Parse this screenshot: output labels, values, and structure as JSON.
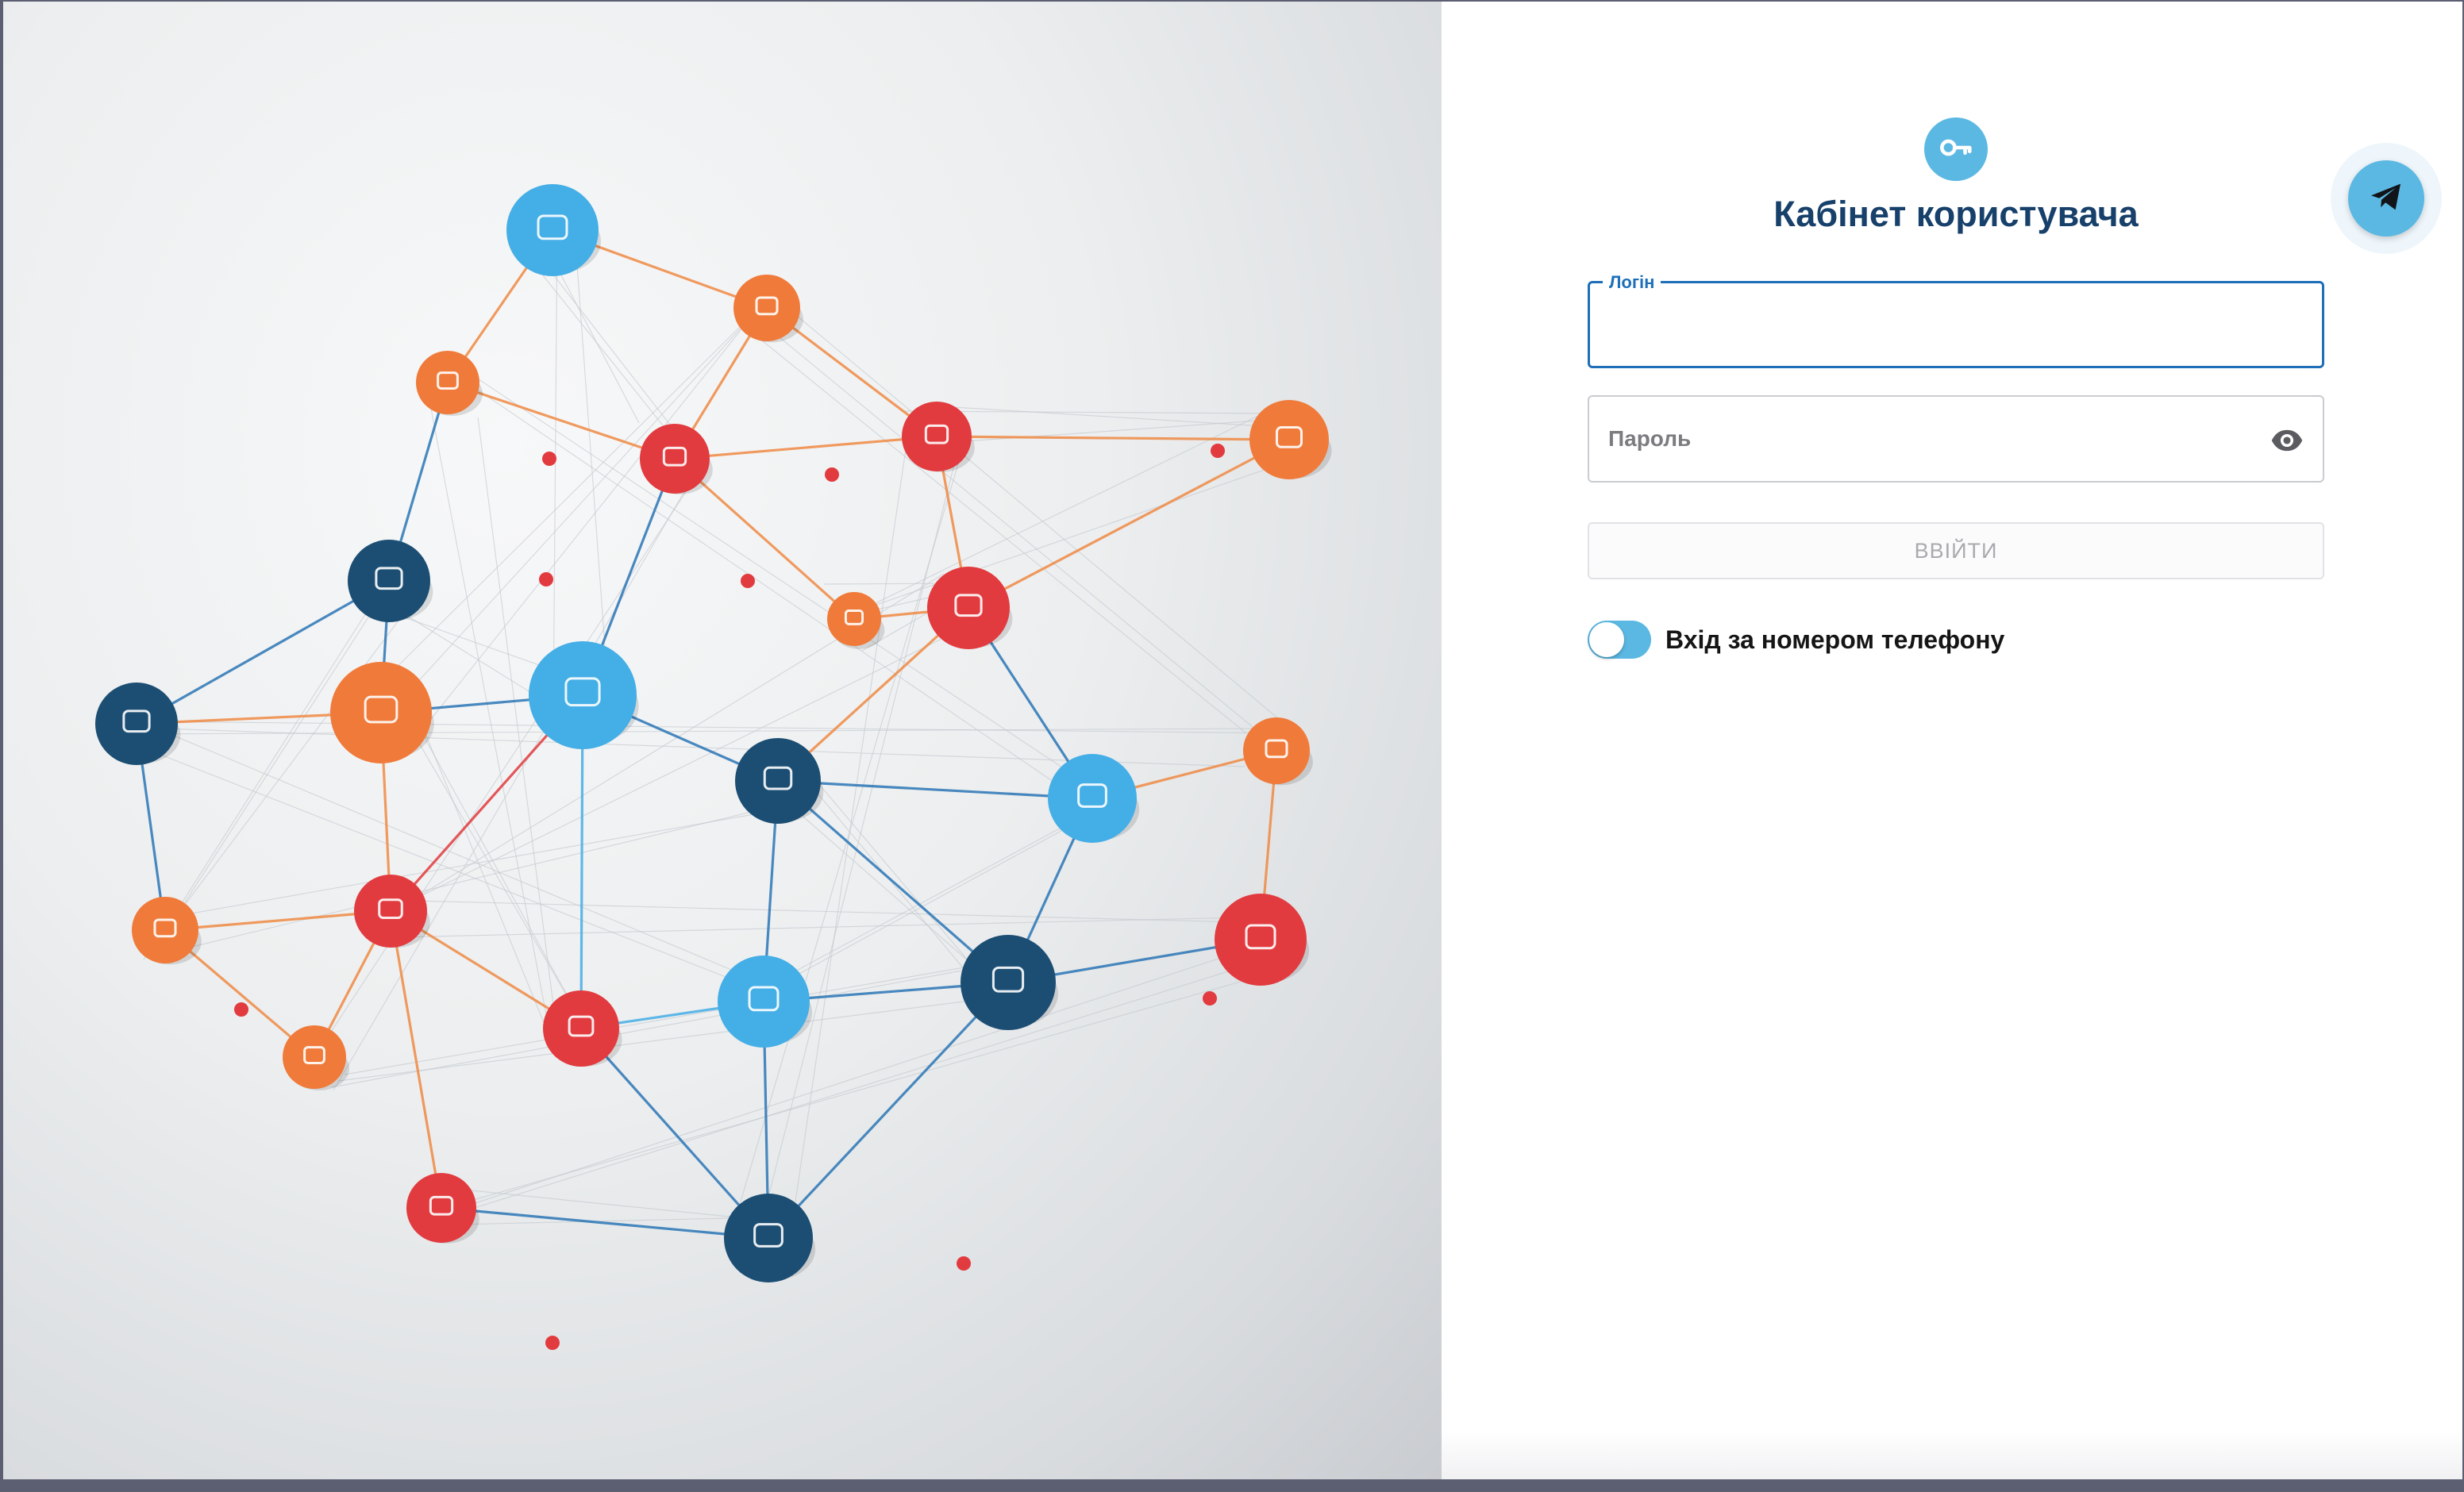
{
  "hero": {
    "image": "network-illustration",
    "colors": {
      "orange": "#f07a3a",
      "red": "#e23b3f",
      "light_blue": "#44aee6",
      "dark_blue": "#1c4e73",
      "line_blue": "#2b76b6",
      "line_orange": "#f08a44"
    }
  },
  "login": {
    "icon": "key-icon",
    "title": "Кабінет користувача",
    "login_field": {
      "label": "Логін",
      "value": ""
    },
    "password_field": {
      "placeholder": "Пароль",
      "value": "",
      "visibility_icon": "eye-icon"
    },
    "submit_label": "ВВІЙТИ",
    "phone_toggle": {
      "label": "Вхід за номером телефону",
      "checked": false
    }
  },
  "telegram": {
    "icon": "telegram-icon"
  },
  "colors": {
    "title": "#17406a",
    "accent": "#1e6fb8",
    "toggle": "#5bb8e2"
  }
}
